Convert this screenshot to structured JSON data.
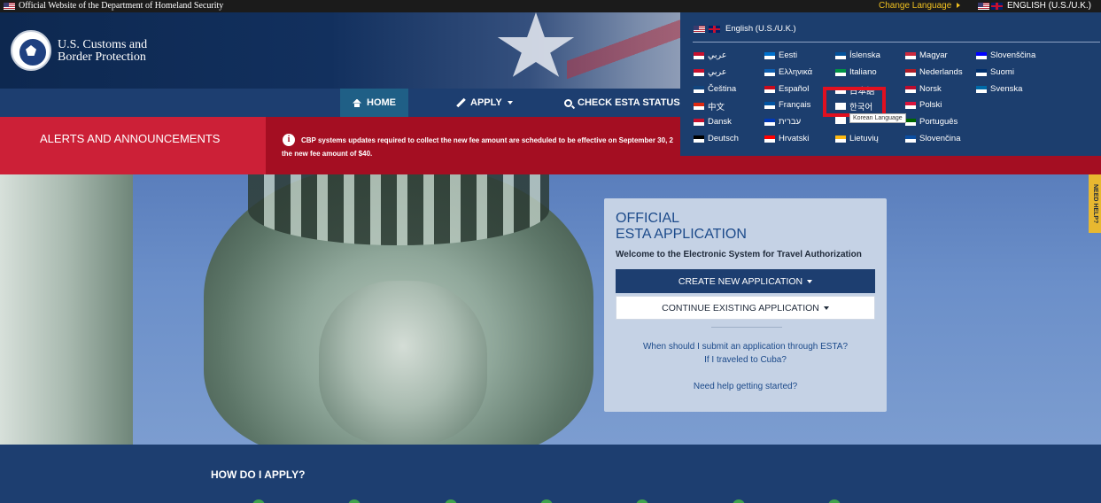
{
  "topbar": {
    "official_text": "Official Website of the Department of Homeland Security",
    "change_language": "Change Language",
    "current_language": "ENGLISH (U.S./U.K.)"
  },
  "header": {
    "agency_line1": "U.S. Customs and",
    "agency_line2": "Border Protection"
  },
  "nav": {
    "home": "HOME",
    "apply": "APPLY",
    "check": "CHECK ESTA STATUS"
  },
  "alerts": {
    "label": "ALERTS AND ANNOUNCEMENTS",
    "line1": "CBP systems updates required to collect the new fee amount are scheduled to be effective on September 30, 2",
    "line2": "the new fee amount of $40."
  },
  "esta": {
    "title_line1": "OFFICIAL",
    "title_line2": "ESTA APPLICATION",
    "welcome": "Welcome to the Electronic System for Travel Authorization",
    "create_btn": "CREATE NEW APPLICATION",
    "continue_btn": "CONTINUE EXISTING APPLICATION",
    "link1": "When should I submit an application through ESTA?",
    "link2": "If I traveled to Cuba?",
    "link3": "Need help getting started?"
  },
  "need_help": "NEED HELP?",
  "howto": {
    "title": "HOW DO I APPLY?"
  },
  "language_menu": {
    "current": "English (U.S./U.K.)",
    "tooltip": "Korean Language",
    "columns": [
      [
        "عربي",
        "عربي",
        "Čeština",
        "中文",
        "Dansk",
        "Deutsch"
      ],
      [
        "Eesti",
        "Ελληνικά",
        "Español",
        "Français",
        "עברית",
        "Hrvatski"
      ],
      [
        "Íslenska",
        "Italiano",
        "日本語",
        "한국어",
        "",
        "Lietuvių"
      ],
      [
        "Magyar",
        "Nederlands",
        "Norsk",
        "Polski",
        "Português",
        "Slovenčina"
      ],
      [
        "Slovenščina",
        "Suomi",
        "Svenska"
      ]
    ],
    "flag_colors": [
      [
        "#c8102e",
        "#c8102e",
        "#11457e",
        "#de2910",
        "#c8102e",
        "#000000"
      ],
      [
        "#0072ce",
        "#0d5eaf",
        "#c60b1e",
        "#0055a4",
        "#0038b8",
        "#ff0000"
      ],
      [
        "#02529c",
        "#009246",
        "#ffffff",
        "#ffffff",
        "#ffffff",
        "#fdb913"
      ],
      [
        "#cd2a3e",
        "#ae1c28",
        "#ba0c2f",
        "#dc143c",
        "#006600",
        "#0b4ea2"
      ],
      [
        "#0000ff",
        "#002f6c",
        "#006aa7"
      ]
    ]
  },
  "colors": {
    "nav_bg": "#1d3e70",
    "alert_red": "#cc2037",
    "highlight": "#e01020"
  }
}
